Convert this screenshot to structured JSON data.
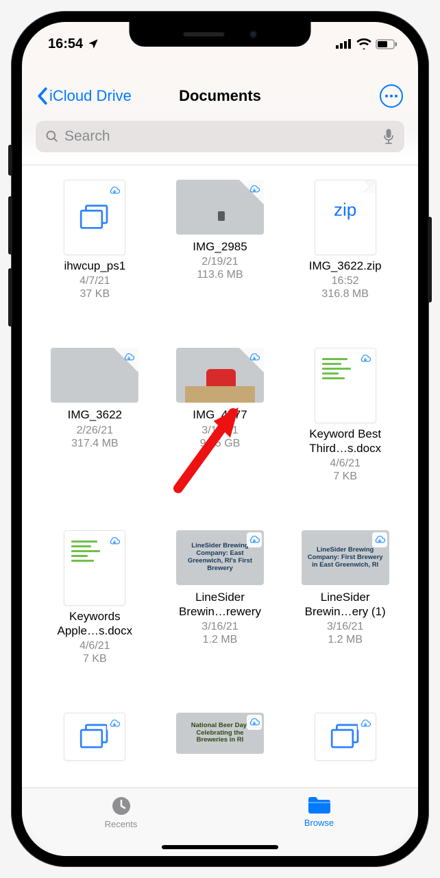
{
  "status": {
    "time": "16:54",
    "location_glyph": "➤"
  },
  "nav": {
    "back_label": "iCloud Drive",
    "title": "Documents"
  },
  "search": {
    "placeholder": "Search"
  },
  "files": [
    {
      "name": "ihwcup_ps1",
      "date": "4/7/21",
      "size": "37 KB",
      "thumb": "stack"
    },
    {
      "name": "IMG_2985",
      "date": "2/19/21",
      "size": "113.6 MB",
      "thumb": "sky"
    },
    {
      "name": "IMG_3622.zip",
      "date": "16:52",
      "size": "316.8 MB",
      "thumb": "zip"
    },
    {
      "name": "IMG_3622",
      "date": "2/26/21",
      "size": "317.4 MB",
      "thumb": "dog"
    },
    {
      "name": "IMG_4477",
      "date": "3/10/21",
      "size": "9.15 GB",
      "thumb": "man"
    },
    {
      "name": "Keyword Best",
      "name2": "Third…s.docx",
      "date": "4/6/21",
      "size": "7 KB",
      "thumb": "docgreen"
    },
    {
      "name": "Keywords",
      "name2": "Apple…s.docx",
      "date": "4/6/21",
      "size": "7 KB",
      "thumb": "docgreen"
    },
    {
      "name": "LineSider",
      "name2": "Brewin…rewery",
      "date": "3/16/21",
      "size": "1.2 MB",
      "thumb": "brew1"
    },
    {
      "name": "LineSider",
      "name2": "Brewin…ery (1)",
      "date": "3/16/21",
      "size": "1.2 MB",
      "thumb": "brew2"
    },
    {
      "name": "",
      "date": "",
      "size": "",
      "thumb": "stack"
    },
    {
      "name": "",
      "date": "",
      "size": "",
      "thumb": "beer"
    },
    {
      "name": "",
      "date": "",
      "size": "",
      "thumb": "stack"
    }
  ],
  "brew_text1": "LineSider Brewing Company: East Greenwich, RI's First Brewery",
  "brew_text2": "LineSider Brewing Company: First Brewery in East Greenwich, RI",
  "beer_text": "National Beer Day: Celebrating the Breweries in RI",
  "zip_label": "zip",
  "tabs": {
    "recents": "Recents",
    "browse": "Browse"
  }
}
